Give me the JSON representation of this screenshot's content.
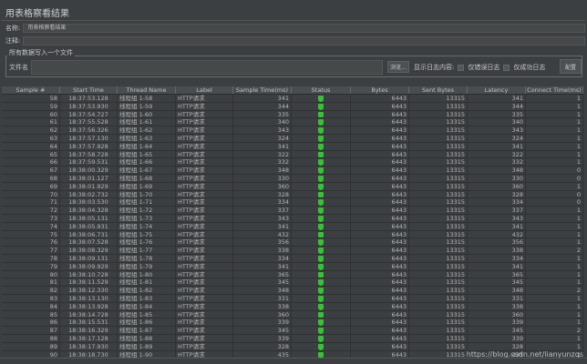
{
  "title": "用表格察看结果",
  "name_label": "名称:",
  "name_value": "用表格察看结果",
  "comment_label": "注释:",
  "comment_value": "",
  "file_group_title": "所有数据写入一个文件",
  "file_label": "文件名",
  "file_value": "",
  "browse_label": "浏览...",
  "log_label": "显示日志内容:",
  "errors_only_label": "仅错误日志",
  "success_only_label": "仅成功日志",
  "configure_label": "配置",
  "columns": [
    "Sample #",
    "Start Time",
    "Thread Name",
    "Label",
    "Sample Time(ms)",
    "Status",
    "Bytes",
    "Sent Bytes",
    "Latency",
    "Connect Time(ms)"
  ],
  "rows": [
    [
      "58",
      "18:37:53.128",
      "线程组 1-58",
      "HTTP请求",
      "341",
      "success",
      "6443",
      "13315",
      "341",
      "1"
    ],
    [
      "59",
      "18:37:53.930",
      "线程组 1-59",
      "HTTP请求",
      "344",
      "success",
      "6443",
      "13315",
      "344",
      "1"
    ],
    [
      "60",
      "18:37:54.727",
      "线程组 1-60",
      "HTTP请求",
      "335",
      "success",
      "6443",
      "13315",
      "335",
      "1"
    ],
    [
      "61",
      "18:37:55.528",
      "线程组 1-61",
      "HTTP请求",
      "340",
      "success",
      "6443",
      "13315",
      "340",
      "1"
    ],
    [
      "62",
      "18:37:56.326",
      "线程组 1-62",
      "HTTP请求",
      "343",
      "success",
      "6443",
      "13315",
      "343",
      "1"
    ],
    [
      "63",
      "18:37:57.130",
      "线程组 1-63",
      "HTTP请求",
      "324",
      "success",
      "6443",
      "13315",
      "324",
      "1"
    ],
    [
      "64",
      "18:37:57.928",
      "线程组 1-64",
      "HTTP请求",
      "341",
      "success",
      "6443",
      "13315",
      "341",
      "1"
    ],
    [
      "65",
      "18:37:58.728",
      "线程组 1-65",
      "HTTP请求",
      "322",
      "success",
      "6443",
      "13315",
      "322",
      "1"
    ],
    [
      "66",
      "18:37:59.531",
      "线程组 1-66",
      "HTTP请求",
      "332",
      "success",
      "6443",
      "13315",
      "332",
      "1"
    ],
    [
      "67",
      "18:38:00.329",
      "线程组 1-67",
      "HTTP请求",
      "348",
      "success",
      "6443",
      "13315",
      "348",
      "0"
    ],
    [
      "68",
      "18:38:01.127",
      "线程组 1-68",
      "HTTP请求",
      "330",
      "success",
      "6443",
      "13315",
      "330",
      "0"
    ],
    [
      "69",
      "18:38:01.929",
      "线程组 1-69",
      "HTTP请求",
      "360",
      "success",
      "6443",
      "13315",
      "360",
      "1"
    ],
    [
      "70",
      "18:38:02.732",
      "线程组 1-70",
      "HTTP请求",
      "328",
      "success",
      "6443",
      "13315",
      "328",
      "0"
    ],
    [
      "71",
      "18:38:03.530",
      "线程组 1-71",
      "HTTP请求",
      "334",
      "success",
      "6443",
      "13315",
      "334",
      "0"
    ],
    [
      "72",
      "18:38:04.328",
      "线程组 1-72",
      "HTTP请求",
      "337",
      "success",
      "6443",
      "13315",
      "337",
      "1"
    ],
    [
      "73",
      "18:38:05.131",
      "线程组 1-73",
      "HTTP请求",
      "343",
      "success",
      "6443",
      "13315",
      "343",
      "1"
    ],
    [
      "74",
      "18:38:05.931",
      "线程组 1-74",
      "HTTP请求",
      "341",
      "success",
      "6443",
      "13315",
      "341",
      "1"
    ],
    [
      "75",
      "18:38:06.731",
      "线程组 1-75",
      "HTTP请求",
      "432",
      "success",
      "6443",
      "13315",
      "432",
      "1"
    ],
    [
      "76",
      "18:38:07.528",
      "线程组 1-76",
      "HTTP请求",
      "356",
      "success",
      "6443",
      "13315",
      "356",
      "1"
    ],
    [
      "77",
      "18:38:08.329",
      "线程组 1-77",
      "HTTP请求",
      "338",
      "success",
      "6443",
      "13315",
      "338",
      "2"
    ],
    [
      "78",
      "18:38:09.131",
      "线程组 1-78",
      "HTTP请求",
      "334",
      "success",
      "6443",
      "13315",
      "334",
      "1"
    ],
    [
      "79",
      "18:38:09.929",
      "线程组 1-79",
      "HTTP请求",
      "341",
      "success",
      "6443",
      "13315",
      "341",
      "1"
    ],
    [
      "80",
      "18:38:10.728",
      "线程组 1-80",
      "HTTP请求",
      "365",
      "success",
      "6443",
      "13315",
      "365",
      "1"
    ],
    [
      "81",
      "18:38:11.529",
      "线程组 1-81",
      "HTTP请求",
      "345",
      "success",
      "6443",
      "13315",
      "345",
      "1"
    ],
    [
      "82",
      "18:38:12.330",
      "线程组 1-82",
      "HTTP请求",
      "348",
      "success",
      "6443",
      "13315",
      "348",
      "2"
    ],
    [
      "83",
      "18:38:13.130",
      "线程组 1-83",
      "HTTP请求",
      "331",
      "success",
      "6443",
      "13315",
      "331",
      "1"
    ],
    [
      "84",
      "18:38:13.928",
      "线程组 1-84",
      "HTTP请求",
      "338",
      "success",
      "6443",
      "13315",
      "338",
      "1"
    ],
    [
      "85",
      "18:38:14.728",
      "线程组 1-85",
      "HTTP请求",
      "360",
      "success",
      "6443",
      "13315",
      "360",
      "1"
    ],
    [
      "86",
      "18:38:15.531",
      "线程组 1-86",
      "HTTP请求",
      "339",
      "success",
      "6443",
      "13315",
      "339",
      "1"
    ],
    [
      "87",
      "18:38:16.329",
      "线程组 1-87",
      "HTTP请求",
      "345",
      "success",
      "6443",
      "13315",
      "345",
      "2"
    ],
    [
      "88",
      "18:38:17.128",
      "线程组 1-88",
      "HTTP请求",
      "339",
      "success",
      "6443",
      "13315",
      "339",
      "1"
    ],
    [
      "89",
      "18:38:17.930",
      "线程组 1-89",
      "HTTP请求",
      "328",
      "success",
      "6443",
      "13315",
      "328",
      "1"
    ],
    [
      "90",
      "18:38:18.730",
      "线程组 1-90",
      "HTTP请求",
      "435",
      "success",
      "6443",
      "13315",
      "435",
      "1"
    ]
  ],
  "watermark": "https://blog.csdn.net/lianyunzqs",
  "colors": {
    "background": "#3c3f41",
    "success": "#3bbf3b"
  }
}
